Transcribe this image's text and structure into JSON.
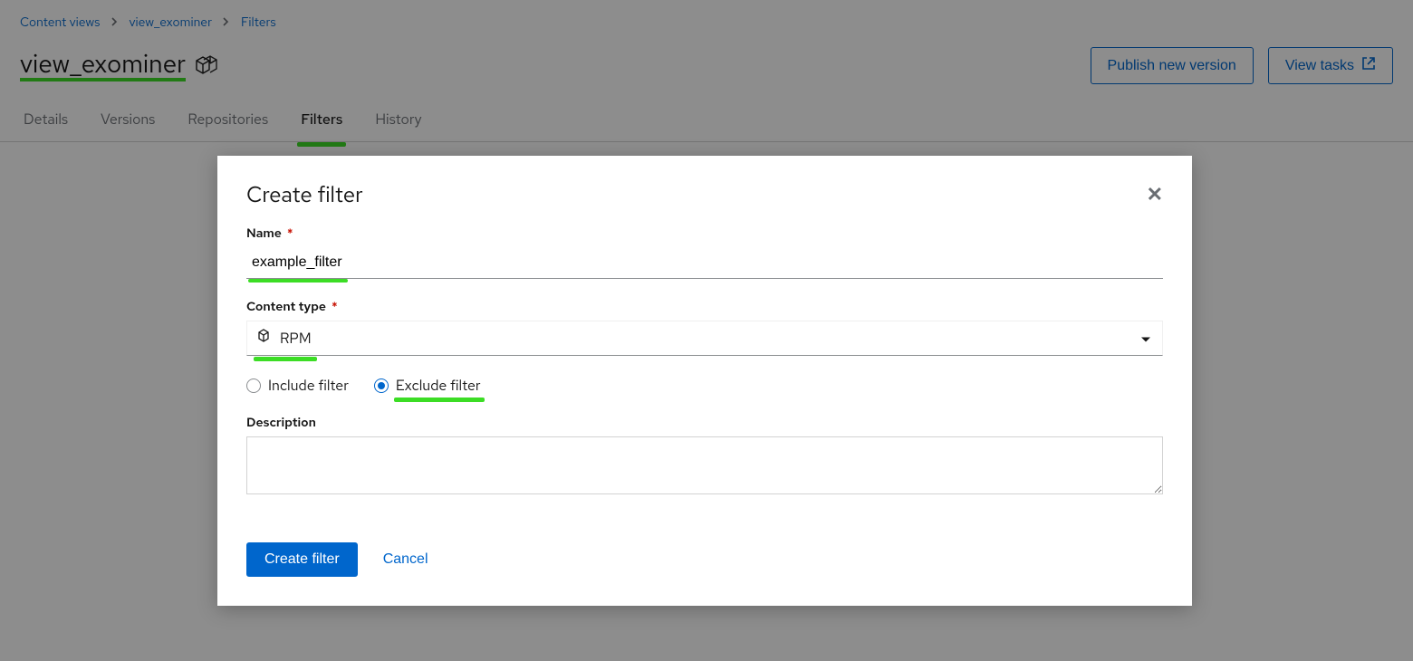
{
  "breadcrumbs": {
    "items": [
      "Content views",
      "view_exominer",
      "Filters"
    ]
  },
  "header": {
    "title": "view_exominer",
    "publish_label": "Publish new version",
    "view_tasks_label": "View tasks"
  },
  "tabs": {
    "items": [
      "Details",
      "Versions",
      "Repositories",
      "Filters",
      "History"
    ],
    "active_index": 3
  },
  "modal": {
    "title": "Create filter",
    "name_label": "Name",
    "name_value": "example_filter",
    "content_type_label": "Content type",
    "content_type_value": "RPM",
    "include_label": "Include filter",
    "exclude_label": "Exclude filter",
    "filter_mode": "exclude",
    "description_label": "Description",
    "description_value": "",
    "create_label": "Create filter",
    "cancel_label": "Cancel"
  }
}
